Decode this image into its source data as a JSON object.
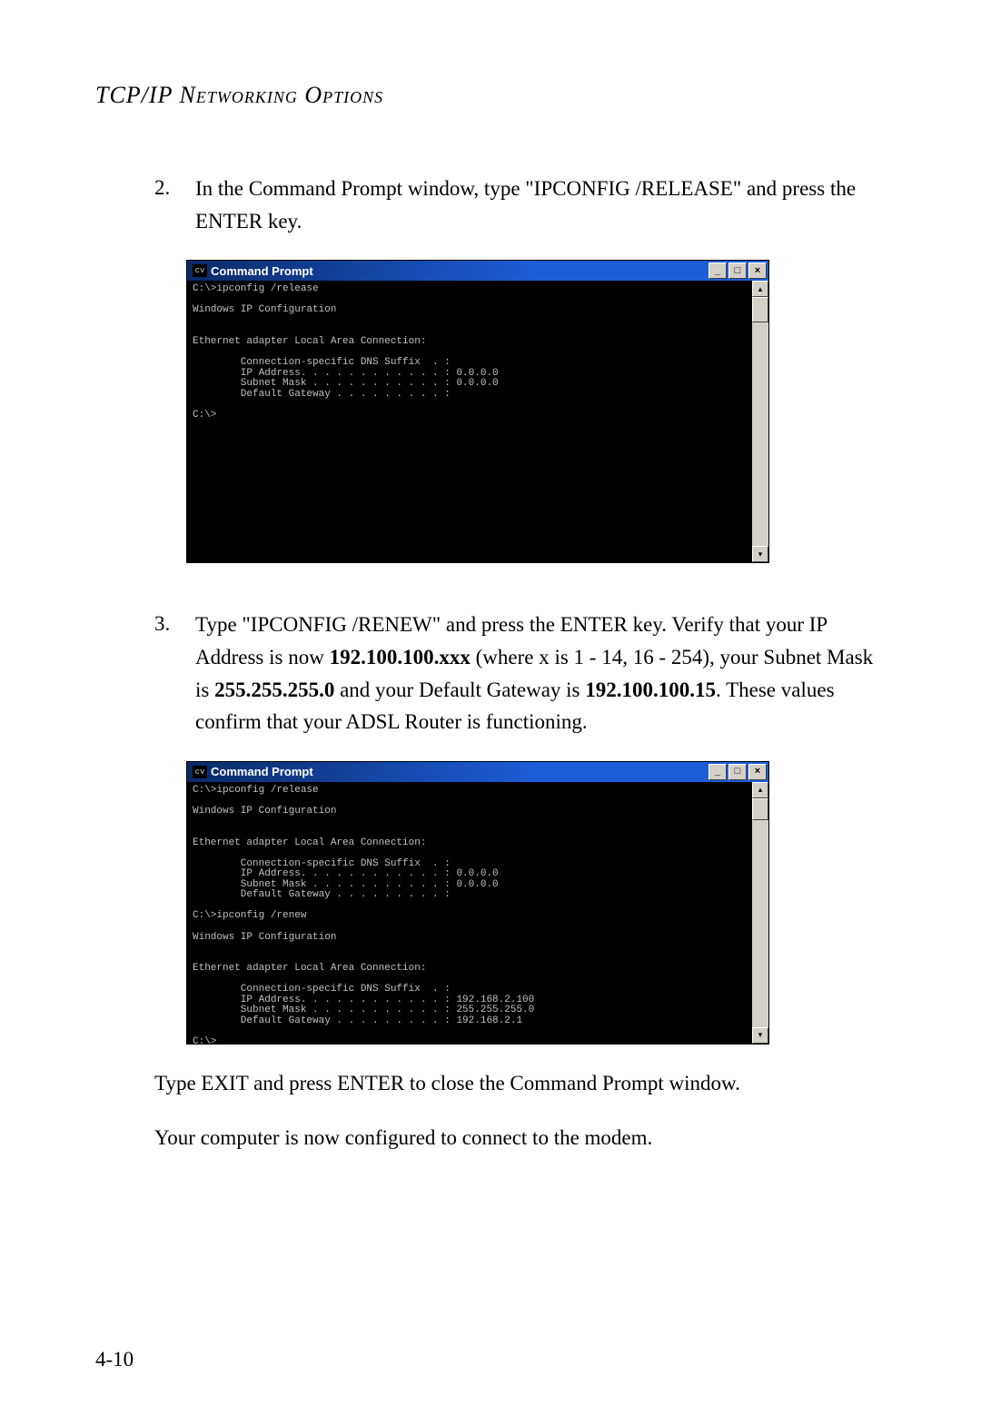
{
  "header": "TCP/IP Networking Options",
  "step2": {
    "num": "2.",
    "text_a": "In the Command Prompt window, type \"IPCONFIG /RELEASE\" and press the ENTER key."
  },
  "cmd1": {
    "title": "Command Prompt",
    "icon": "cv",
    "content": "C:\\>ipconfig /release\n\nWindows IP Configuration\n\n\nEthernet adapter Local Area Connection:\n\n        Connection-specific DNS Suffix  . :\n        IP Address. . . . . . . . . . . . : 0.0.0.0\n        Subnet Mask . . . . . . . . . . . : 0.0.0.0\n        Default Gateway . . . . . . . . . :\n\nC:\\>\n\n\n\n\n\n\n\n\n\n ",
    "height": "310"
  },
  "step3": {
    "num": "3.",
    "text_a": "Type \"IPCONFIG /RENEW\" and press the ENTER key. Verify that your IP Address is now ",
    "bold_a": "192.100.100.xxx",
    "text_b": " (where x is 1 - 14, 16 - 254), your Subnet Mask is ",
    "bold_b": "255.255.255.0",
    "text_c": " and your Default Gateway is ",
    "bold_c": "192.100.100.15",
    "text_d": ". These values confirm that your ADSL Router is functioning."
  },
  "cmd2": {
    "title": "Command Prompt",
    "icon": "cv",
    "content": "C:\\>ipconfig /release\n\nWindows IP Configuration\n\n\nEthernet adapter Local Area Connection:\n\n        Connection-specific DNS Suffix  . :\n        IP Address. . . . . . . . . . . . : 0.0.0.0\n        Subnet Mask . . . . . . . . . . . : 0.0.0.0\n        Default Gateway . . . . . . . . . :\n\nC:\\>ipconfig /renew\n\nWindows IP Configuration\n\n\nEthernet adapter Local Area Connection:\n\n        Connection-specific DNS Suffix  . :\n        IP Address. . . . . . . . . . . . : 192.168.2.100\n        Subnet Mask . . . . . . . . . . . : 255.255.255.0\n        Default Gateway . . . . . . . . . : 192.168.2.1\n\nC:\\>_",
    "height": "290"
  },
  "para1": "Type EXIT and press ENTER to close the Command Prompt window.",
  "para2": "Your computer is now configured to connect to the modem.",
  "page_number": "4-10",
  "buttons": {
    "minimize": "_",
    "maximize": "□",
    "close": "×",
    "up": "▴",
    "down": "▾"
  }
}
